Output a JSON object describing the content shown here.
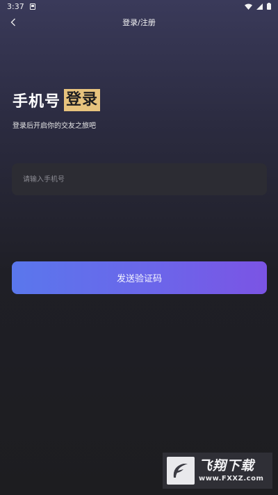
{
  "status_bar": {
    "time": "3:37"
  },
  "header": {
    "title": "登录/注册"
  },
  "heading": {
    "text": "手机号",
    "highlight": "登录",
    "subtitle": "登录后开启你的交友之旅吧"
  },
  "form": {
    "phone_placeholder": "请输入手机号",
    "phone_value": "",
    "send_code_label": "发送验证码"
  },
  "watermark": {
    "name": "飞翔下载",
    "url": "www.FXXZ.com"
  },
  "colors": {
    "accent_highlight": "#e7c37e",
    "button_start": "#5a77ec",
    "button_end": "#7b54e4",
    "background": "#1d1d20"
  }
}
